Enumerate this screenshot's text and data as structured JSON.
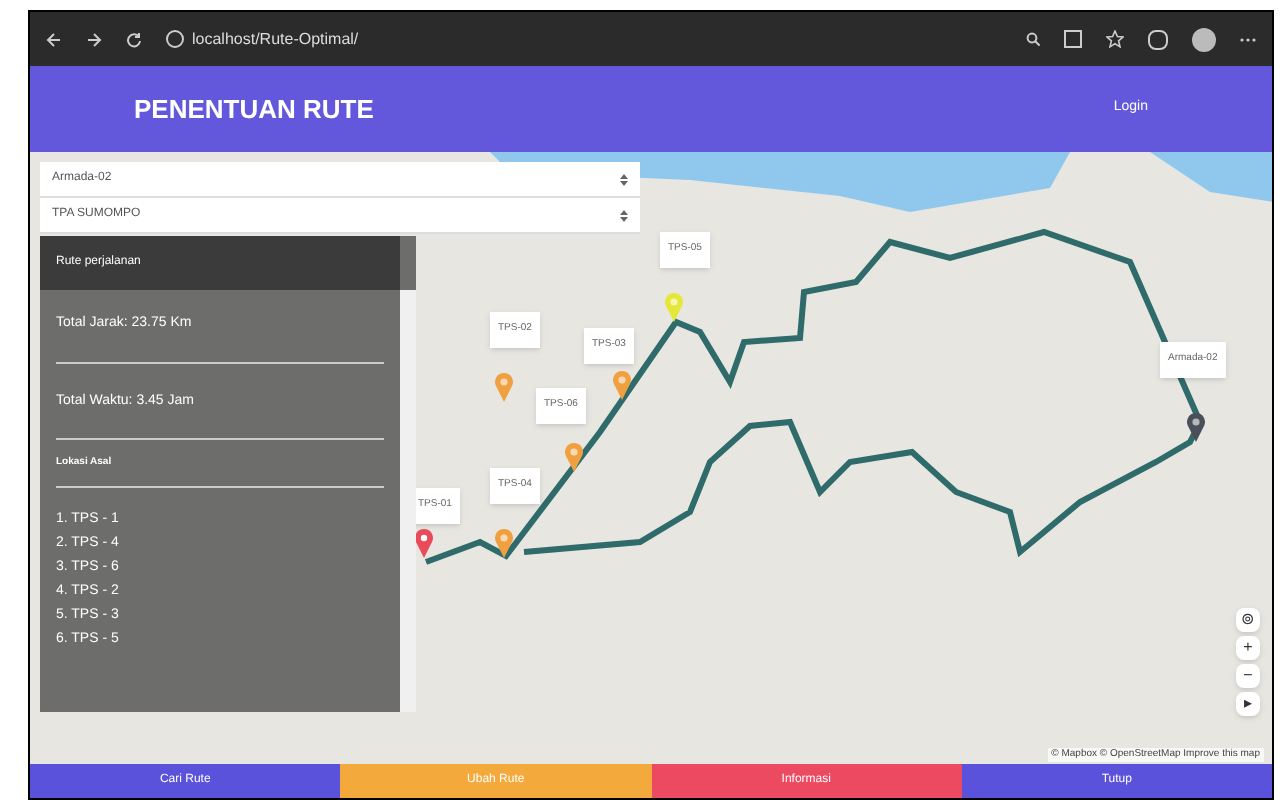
{
  "browser": {
    "url": "localhost/Rute-Optimal/"
  },
  "navbar": {
    "title": "PENENTUAN RUTE",
    "login": "Login"
  },
  "selects": [
    {
      "value": "Armada-02"
    },
    {
      "value": "TPA SUMOMPO"
    }
  ],
  "route_panel": {
    "title": "Rute perjalanan",
    "total_distance": "Total Jarak: 23.75 Km",
    "total_time": "Total Waktu: 3.45 Jam",
    "origin_heading": "Lokasi Asal",
    "stops": [
      "1. TPS - 1",
      "2. TPS - 4",
      "3. TPS - 6",
      "4. TPS - 2",
      "5. TPS - 3",
      "6. TPS - 5"
    ]
  },
  "markers": [
    {
      "label": "TPS-01",
      "kind": "start",
      "color": "#e94b5b"
    },
    {
      "label": "TPS-02",
      "kind": "stop",
      "color": "#f0a040"
    },
    {
      "label": "TPS-03",
      "kind": "stop",
      "color": "#f0a040"
    },
    {
      "label": "TPS-04",
      "kind": "stop",
      "color": "#f0a040"
    },
    {
      "label": "TPS-05",
      "kind": "stop",
      "color": "#e5e83a"
    },
    {
      "label": "TPS-06",
      "kind": "stop",
      "color": "#f0a040"
    },
    {
      "label": "Armada-02",
      "kind": "vehicle",
      "color": "#4a4f5a"
    }
  ],
  "map_controls": [
    "⊚",
    "+",
    "−",
    "▸"
  ],
  "attribution": "© Mapbox © OpenStreetMap Improve this map",
  "bottom_buttons": [
    {
      "label": "Cari Rute",
      "color": "#5b52db"
    },
    {
      "label": "Ubah Rute",
      "color": "#f3a93b"
    },
    {
      "label": "Informasi",
      "color": "#ec4a60"
    },
    {
      "label": "Tutup",
      "color": "#5b52db"
    }
  ]
}
